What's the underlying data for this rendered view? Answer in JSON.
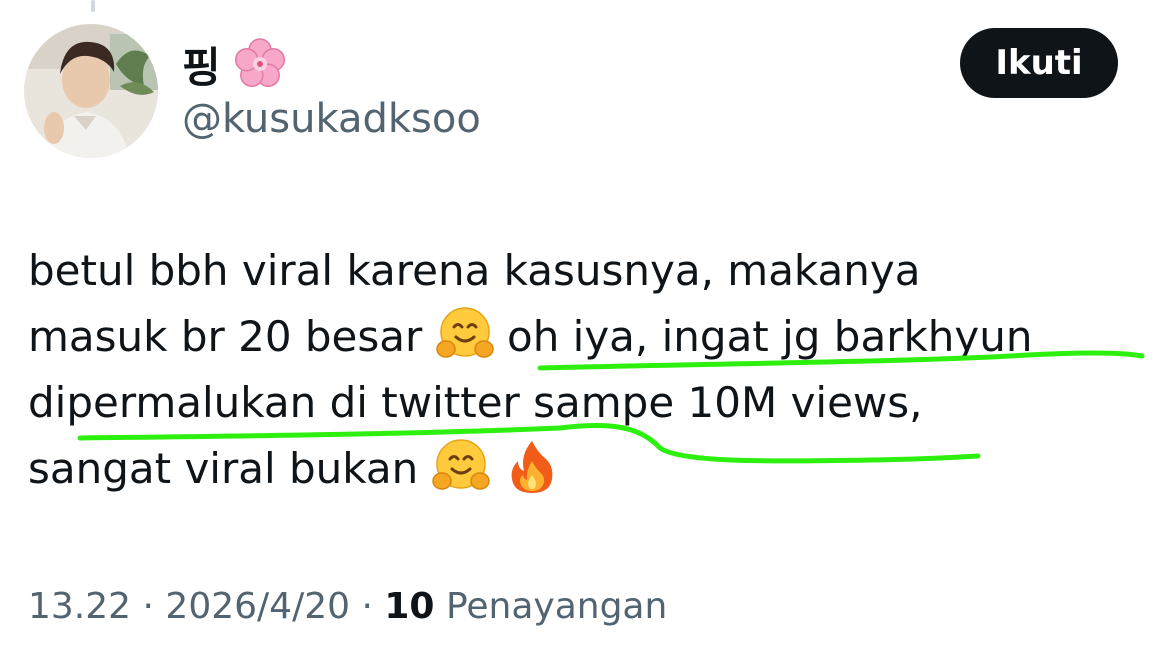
{
  "author": {
    "display_name": "핑",
    "display_name_emoji": "cherry-blossom-icon",
    "handle": "@kusukadksoo"
  },
  "follow_button": {
    "label": "Ikuti"
  },
  "tweet": {
    "lines": [
      {
        "text": "betul bbh viral karena kasusnya, makanya"
      },
      {
        "text_before": "masuk br 20 besar ",
        "emoji": "hugging-face-icon",
        "text_after": " oh iya, ingat jg barkhyun"
      },
      {
        "text": "dipermalukan di twitter sampe 10M views,"
      },
      {
        "text_before": "sangat viral bukan ",
        "emojis": [
          "hugging-face-icon",
          "fire-icon"
        ]
      }
    ]
  },
  "meta": {
    "time": "13.22",
    "separator": "·",
    "date": "2026/4/20",
    "views_count": "10",
    "views_label": "Penayangan"
  },
  "colors": {
    "text": "#0f1419",
    "secondary_text": "#536471",
    "button_bg": "#0f1419",
    "highlight_stroke": "#2ef00f"
  }
}
